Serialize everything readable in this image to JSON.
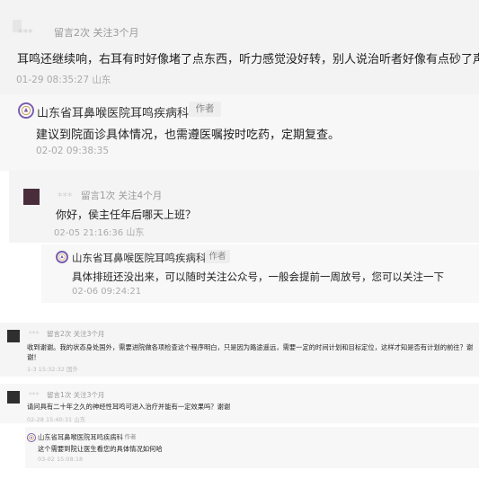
{
  "block1": {
    "meta_name": "***",
    "meta_stats": "留言2次 关注3个月",
    "comment": "耳鸣还继续响，右耳有时好像堵了点东西，听力感觉没好转，别人说治听者好像有点砂了声音",
    "time": "01-29 08:35:27 山东",
    "reply": {
      "hospital": "山东省耳鼻喉医院耳鸣疾病科",
      "author_tag": "作者",
      "text": "建议到院面诊具体情况，也需遵医嘱按时吃药，定期复查。",
      "time": "02-02 09:38:35"
    }
  },
  "block2": {
    "meta_name": "***",
    "meta_stats": "留言1次 关注4个月",
    "comment": "你好，侯主任年后哪天上班？",
    "time": "02-05 21:16:36 山东",
    "reply": {
      "hospital": "山东省耳鼻喉医院耳鸣疾病科",
      "author_tag": "作者",
      "text": "具体排班还没出来，可以随时关注公众号，一般会提前一周放号，您可以关注一下",
      "time": "02-06 09:24:21"
    }
  },
  "block3": {
    "meta_name": "***",
    "meta_stats": "留言2次 关注3个月",
    "comment_line1": "收到谢谢。我的状态身处国外，需要进院做各项检查这个程序明白，只是因为路途遥远，需要一定的时间计划和目标定位，这样才知是否有计划的前往？谢",
    "comment_line2": "谢！",
    "time": "1-3 15:32:32 国外"
  },
  "block4": {
    "meta_name": "***",
    "meta_stats": "留言1次 关注3个月",
    "comment": "请问具有二十年之久的神经性耳鸣可进入治疗并能有一定效果吗？谢谢",
    "time": "02-28 15:40:31 山东",
    "reply": {
      "hospital": "山东省耳鼻喉医院耳鸣疾病科",
      "author_tag": "作者",
      "text": "这个需要到院让医生看您的具体情况如何哈",
      "time": "03-02 15:08:18"
    }
  }
}
